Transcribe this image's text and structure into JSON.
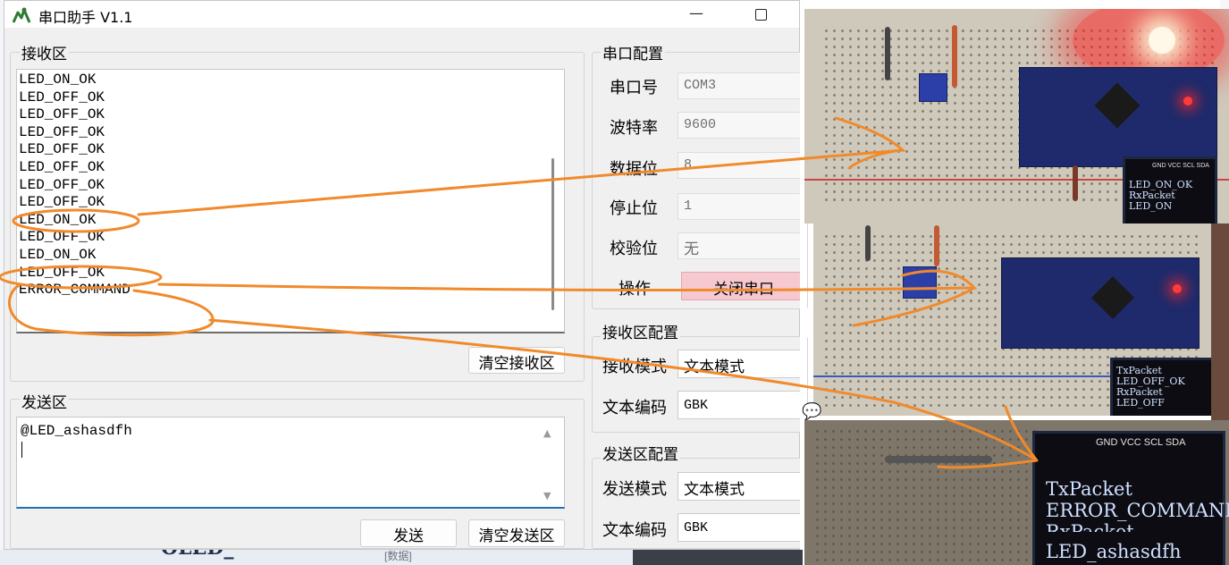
{
  "window": {
    "title": "串口助手 V1.1",
    "minimize_glyph": "—",
    "icon": "app-logo-icon"
  },
  "receive": {
    "group_title": "接收区",
    "lines": [
      "LED_ON_OK",
      "LED_OFF_OK",
      "LED_OFF_OK",
      "LED_OFF_OK",
      "LED_OFF_OK",
      "LED_OFF_OK",
      "LED_OFF_OK",
      "LED_OFF_OK",
      "LED_ON_OK",
      "LED_OFF_OK",
      "LED_ON_OK",
      "LED_OFF_OK",
      "ERROR_COMMAND"
    ],
    "clear_button": "清空接收区"
  },
  "send": {
    "group_title": "发送区",
    "text": "@LED_ashasdfh",
    "send_button": "发送",
    "clear_button": "清空发送区"
  },
  "serial_config": {
    "group_title": "串口配置",
    "port_label": "串口号",
    "port_value": "COM3",
    "baud_label": "波特率",
    "baud_value": "9600",
    "databits_label": "数据位",
    "databits_value": "8",
    "stopbits_label": "停止位",
    "stopbits_value": "1",
    "parity_label": "校验位",
    "parity_value": "无",
    "action_label": "操作",
    "action_button": "关闭串口"
  },
  "receive_config": {
    "group_title": "接收区配置",
    "mode_label": "接收模式",
    "mode_value": "文本模式",
    "encoding_label": "文本编码",
    "encoding_value": "GBK"
  },
  "send_config": {
    "group_title": "发送区配置",
    "mode_label": "发送模式",
    "mode_value": "文本模式",
    "encoding_label": "文本编码",
    "encoding_value": "GBK"
  },
  "photos": {
    "photo1": {
      "oled_header": "GND VCC SCL SDA",
      "oled_lines": [
        "LED_ON_OK",
        "RxPacket",
        "LED_ON"
      ]
    },
    "photo2": {
      "oled_lines": [
        "TxPacket",
        "LED_OFF_OK",
        "RxPacket",
        "LED_OFF"
      ]
    },
    "photo3": {
      "oled_header": "GND VCC SCL SDA",
      "oled_lines": [
        "TxPacket",
        "ERROR_COMMAND",
        "RxPacket",
        "LED_ashasdfh"
      ]
    }
  },
  "background": {
    "bottom_text": "OLED_",
    "bottom_small": "[数据]"
  },
  "colors": {
    "annotation_orange": "#f08a2c",
    "close_button_bg": "#f6c8cf",
    "send_focus_line": "#1f6fb5"
  }
}
